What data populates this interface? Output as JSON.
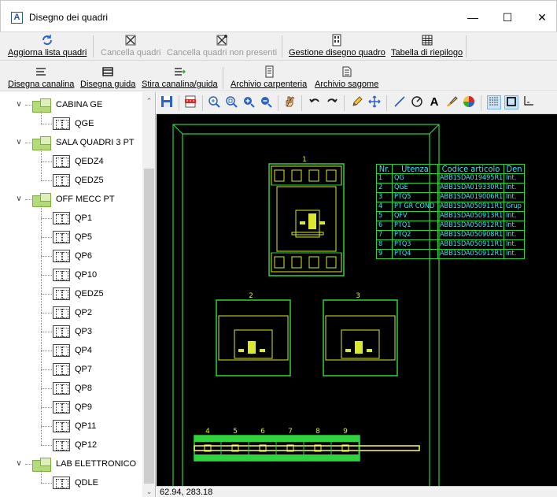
{
  "window": {
    "title": "Disegno dei quadri",
    "app_icon_glyph": "A",
    "minimize_glyph": "—",
    "maximize_glyph": "☐",
    "close_glyph": "✕"
  },
  "toolbar1": {
    "aggiorna": "Aggiorna lista quadri",
    "cancella": "Cancella quadri",
    "cancella_non": "Cancella quadri non presenti",
    "gestione": "Gestione disegno quadro",
    "tabella": "Tabella di riepilogo"
  },
  "toolbar2": {
    "disegna_canalina": "Disegna canalina",
    "disegna_guida": "Disegna guida",
    "stira": "Stira canalina/guida",
    "archivio_carpenteria": "Archivio carpenteria",
    "archivio_sagome": "Archivio sagome"
  },
  "tree": {
    "groups": [
      {
        "label": "CABINA GE",
        "children": [
          "QGE"
        ]
      },
      {
        "label": "SALA QUADRI 3 PT",
        "children": [
          "QEDZ4",
          "QEDZ5"
        ]
      },
      {
        "label": "OFF MECC PT",
        "children": [
          "QP1",
          "QP5",
          "QP6",
          "QP10",
          "QEDZ5",
          "QP2",
          "QP3",
          "QP4",
          "QP7",
          "QP8",
          "QP9",
          "QP11",
          "QP12"
        ]
      },
      {
        "label": "LAB ELETTRONICO",
        "children": [
          "QDLE"
        ]
      }
    ]
  },
  "drawing": {
    "colors": {
      "frame": "#2fd33c",
      "equipment": "#d9e82c",
      "text": "#3fe0f5",
      "rail": "#ffff55",
      "header": "#3fe0f5"
    },
    "component_numbers": [
      "1",
      "2",
      "3"
    ],
    "rail_numbers": [
      "4",
      "5",
      "6",
      "7",
      "8",
      "9"
    ],
    "bom_headers": [
      "Nr.",
      "Utenza",
      "Codice articolo",
      "Den"
    ],
    "bom_rows": [
      [
        "1",
        "QG",
        "ABB1SDA019495R1",
        "Int."
      ],
      [
        "2",
        "QGE",
        "ABB1SDA019330R1",
        "Int."
      ],
      [
        "3",
        "PTQ5",
        "ABB1SDA019006R1",
        "Int."
      ],
      [
        "4",
        "PT GR COND",
        "ABB1SDA050911R1",
        "Grup"
      ],
      [
        "5",
        "QFV",
        "ABB1SDA050913R1",
        "Int."
      ],
      [
        "6",
        "PTQ1",
        "ABB1SDA050912R1",
        "Int."
      ],
      [
        "7",
        "PTQ2",
        "ABB1SDA050908R1",
        "Int."
      ],
      [
        "8",
        "PTQ3",
        "ABB1SDA050911R1",
        "Int."
      ],
      [
        "9",
        "PTQ4",
        "ABB1SDA050912R1",
        "Int."
      ]
    ]
  },
  "status": {
    "coords": "62.94, 283.18"
  }
}
